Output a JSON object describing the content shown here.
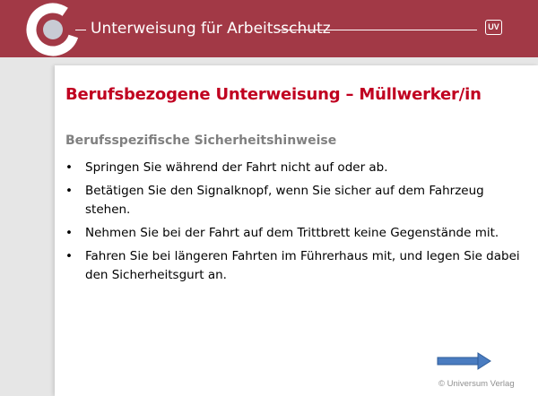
{
  "header": {
    "title": "Unterweisung für Arbeitsschutz",
    "badge": "UV"
  },
  "slide": {
    "title": "Berufsbezogene Unterweisung – Müllwerker/in",
    "section_heading": "Berufsspezifische Sicherheitshinweise",
    "bullet_symbol": "•",
    "bullets": [
      "Springen Sie während der Fahrt nicht auf oder ab.",
      "Betätigen Sie den Signalknopf, wenn Sie sicher auf dem Fahrzeug stehen.",
      "Nehmen Sie bei der Fahrt auf dem Trittbrett keine Gegenstände mit.",
      "Fahren Sie bei längeren Fahrten im Führerhaus mit, und legen Sie dabei den Sicherheitsgurt an."
    ]
  },
  "footer": {
    "copyright": "© Universum Verlag"
  },
  "icons": {
    "logo": "ring-logo-icon",
    "next": "next-arrow-icon"
  },
  "colors": {
    "header_bg": "#a23946",
    "title_red": "#c00020",
    "heading_gray": "#808080",
    "arrow_blue": "#4a7cc0"
  }
}
